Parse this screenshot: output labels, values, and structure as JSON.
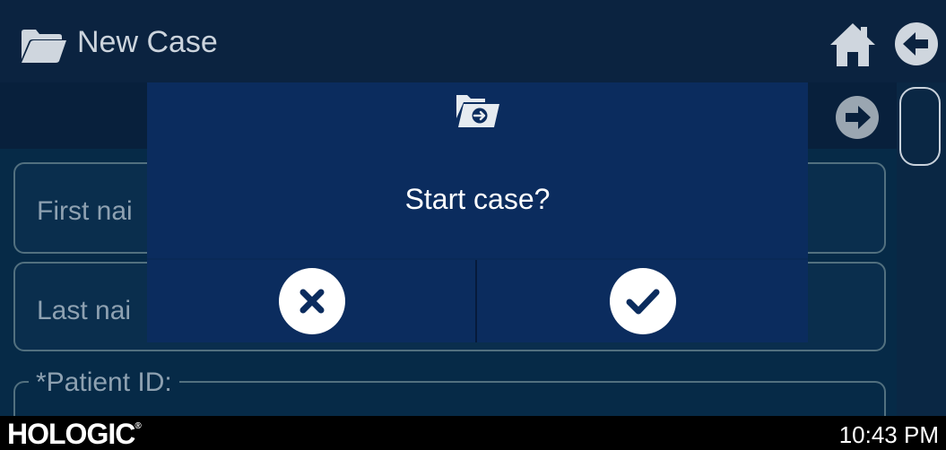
{
  "header": {
    "title": "New Case",
    "icon_folder": "folder-icon",
    "icon_home": "home-icon",
    "icon_back": "back-arrow-icon"
  },
  "subbar": {
    "icon_forward": "forward-arrow-icon"
  },
  "form": {
    "first_name_label": "First nai",
    "last_name_label": "Last nai",
    "patient_id_label": "*Patient ID:"
  },
  "dialog": {
    "icon": "folder-start-icon",
    "message": "Start case?",
    "cancel_icon": "close-icon",
    "confirm_icon": "checkmark-icon"
  },
  "statusbar": {
    "brand": "HOLOGIC",
    "brand_mark": "®",
    "time": "10:43 PM"
  },
  "colors": {
    "background": "#062a47",
    "header": "#0b2340",
    "dialog": "#0b2c5e",
    "text": "#ffffff",
    "muted_text": "#8ea1b1",
    "field_border": "#52707f"
  }
}
